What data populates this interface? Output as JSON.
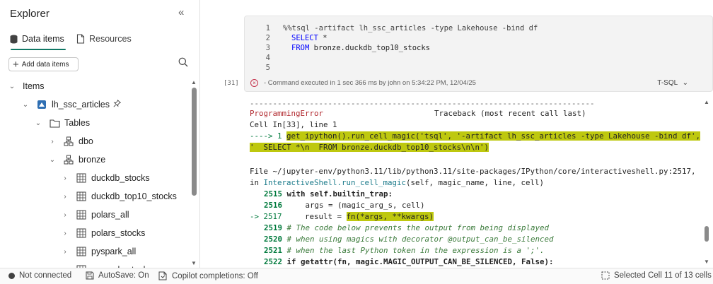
{
  "explorer": {
    "title": "Explorer",
    "collapse_label": "«",
    "tabs": [
      {
        "label": "Data items"
      },
      {
        "label": "Resources"
      }
    ],
    "add_button": "Add data items",
    "tree": [
      {
        "label": "Items",
        "chevron": "⌄"
      },
      {
        "label": "lh_ssc_articles",
        "chevron": "⌄"
      },
      {
        "label": "Tables",
        "chevron": "⌄"
      },
      {
        "label": "dbo",
        "chevron": "›"
      },
      {
        "label": "bronze",
        "chevron": "⌄"
      },
      {
        "label": "duckdb_stocks",
        "chevron": "›"
      },
      {
        "label": "duckdb_top10_stocks",
        "chevron": "›"
      },
      {
        "label": "polars_all",
        "chevron": "›"
      },
      {
        "label": "polars_stocks",
        "chevron": "›"
      },
      {
        "label": "pyspark_all",
        "chevron": "›"
      },
      {
        "label": "pyspark_stocks",
        "chevron": "›"
      }
    ]
  },
  "cell": {
    "line_numbers": [
      "1",
      "2",
      "3",
      "4",
      "5"
    ],
    "code": {
      "l1": "%%tsql -artifact lh_ssc_articles -type Lakehouse -bind df",
      "l2_kw": "SELECT",
      "l2_rest": " *",
      "l3_kw": "FROM",
      "l3_rest": " bronze.duckdb_top10_stocks"
    },
    "status": "- Command executed in 1 sec 366 ms by john on 5:34:22 PM, 12/04/25",
    "language": "T-SQL",
    "exec_count": "[31]"
  },
  "output": {
    "rule": "---------------------------------------------------------------------------",
    "error_name": "ProgrammingError",
    "traceback_label": "Traceback (most recent call last)",
    "cell_ref": "Cell In[33], line 1",
    "arrow1": "----> 1 ",
    "call1": "get_ipython().run_cell_magic('tsql', '-artifact lh_ssc_articles -type Lakehouse -bind df',",
    "call2": "'  SELECT *\\n  FROM bronze.duckdb_top10_stocks\\n\\n')",
    "file_path": "File ~/jupyter-env/python3.11/lib/python3.11/site-packages/IPython/core/interactiveshell.py:2517,",
    "in_word": "in ",
    "func": "InteractiveShell.run_cell_magic",
    "func_args": "(self, magic_name, line, cell)",
    "ln2515": "2515",
    "c2515": " with self.builtin_trap:",
    "ln2516": "2516",
    "c2516": "     args = (magic_arg_s, cell)",
    "arrow2": "-> 2517",
    "c2517a": "     result = ",
    "c2517b": "fn(*args, **kwargs)",
    "ln2519": "2519",
    "c2519": " # The code below prevents the output from being displayed",
    "ln2520": "2520",
    "c2520": " # when using magics with decorator @output_can_be_silenced",
    "ln2521": "2521",
    "c2521": " # when the last Python token in the expression is a ';'.",
    "ln2522": "2522",
    "c2522": " if getattr(fn, magic.MAGIC_OUTPUT_CAN_BE_SILENCED, False):"
  },
  "statusbar": {
    "connection": "Not connected",
    "autosave": "AutoSave: On",
    "copilot": "Copilot completions: Off",
    "selection": "Selected Cell 11 of 13 cells"
  }
}
